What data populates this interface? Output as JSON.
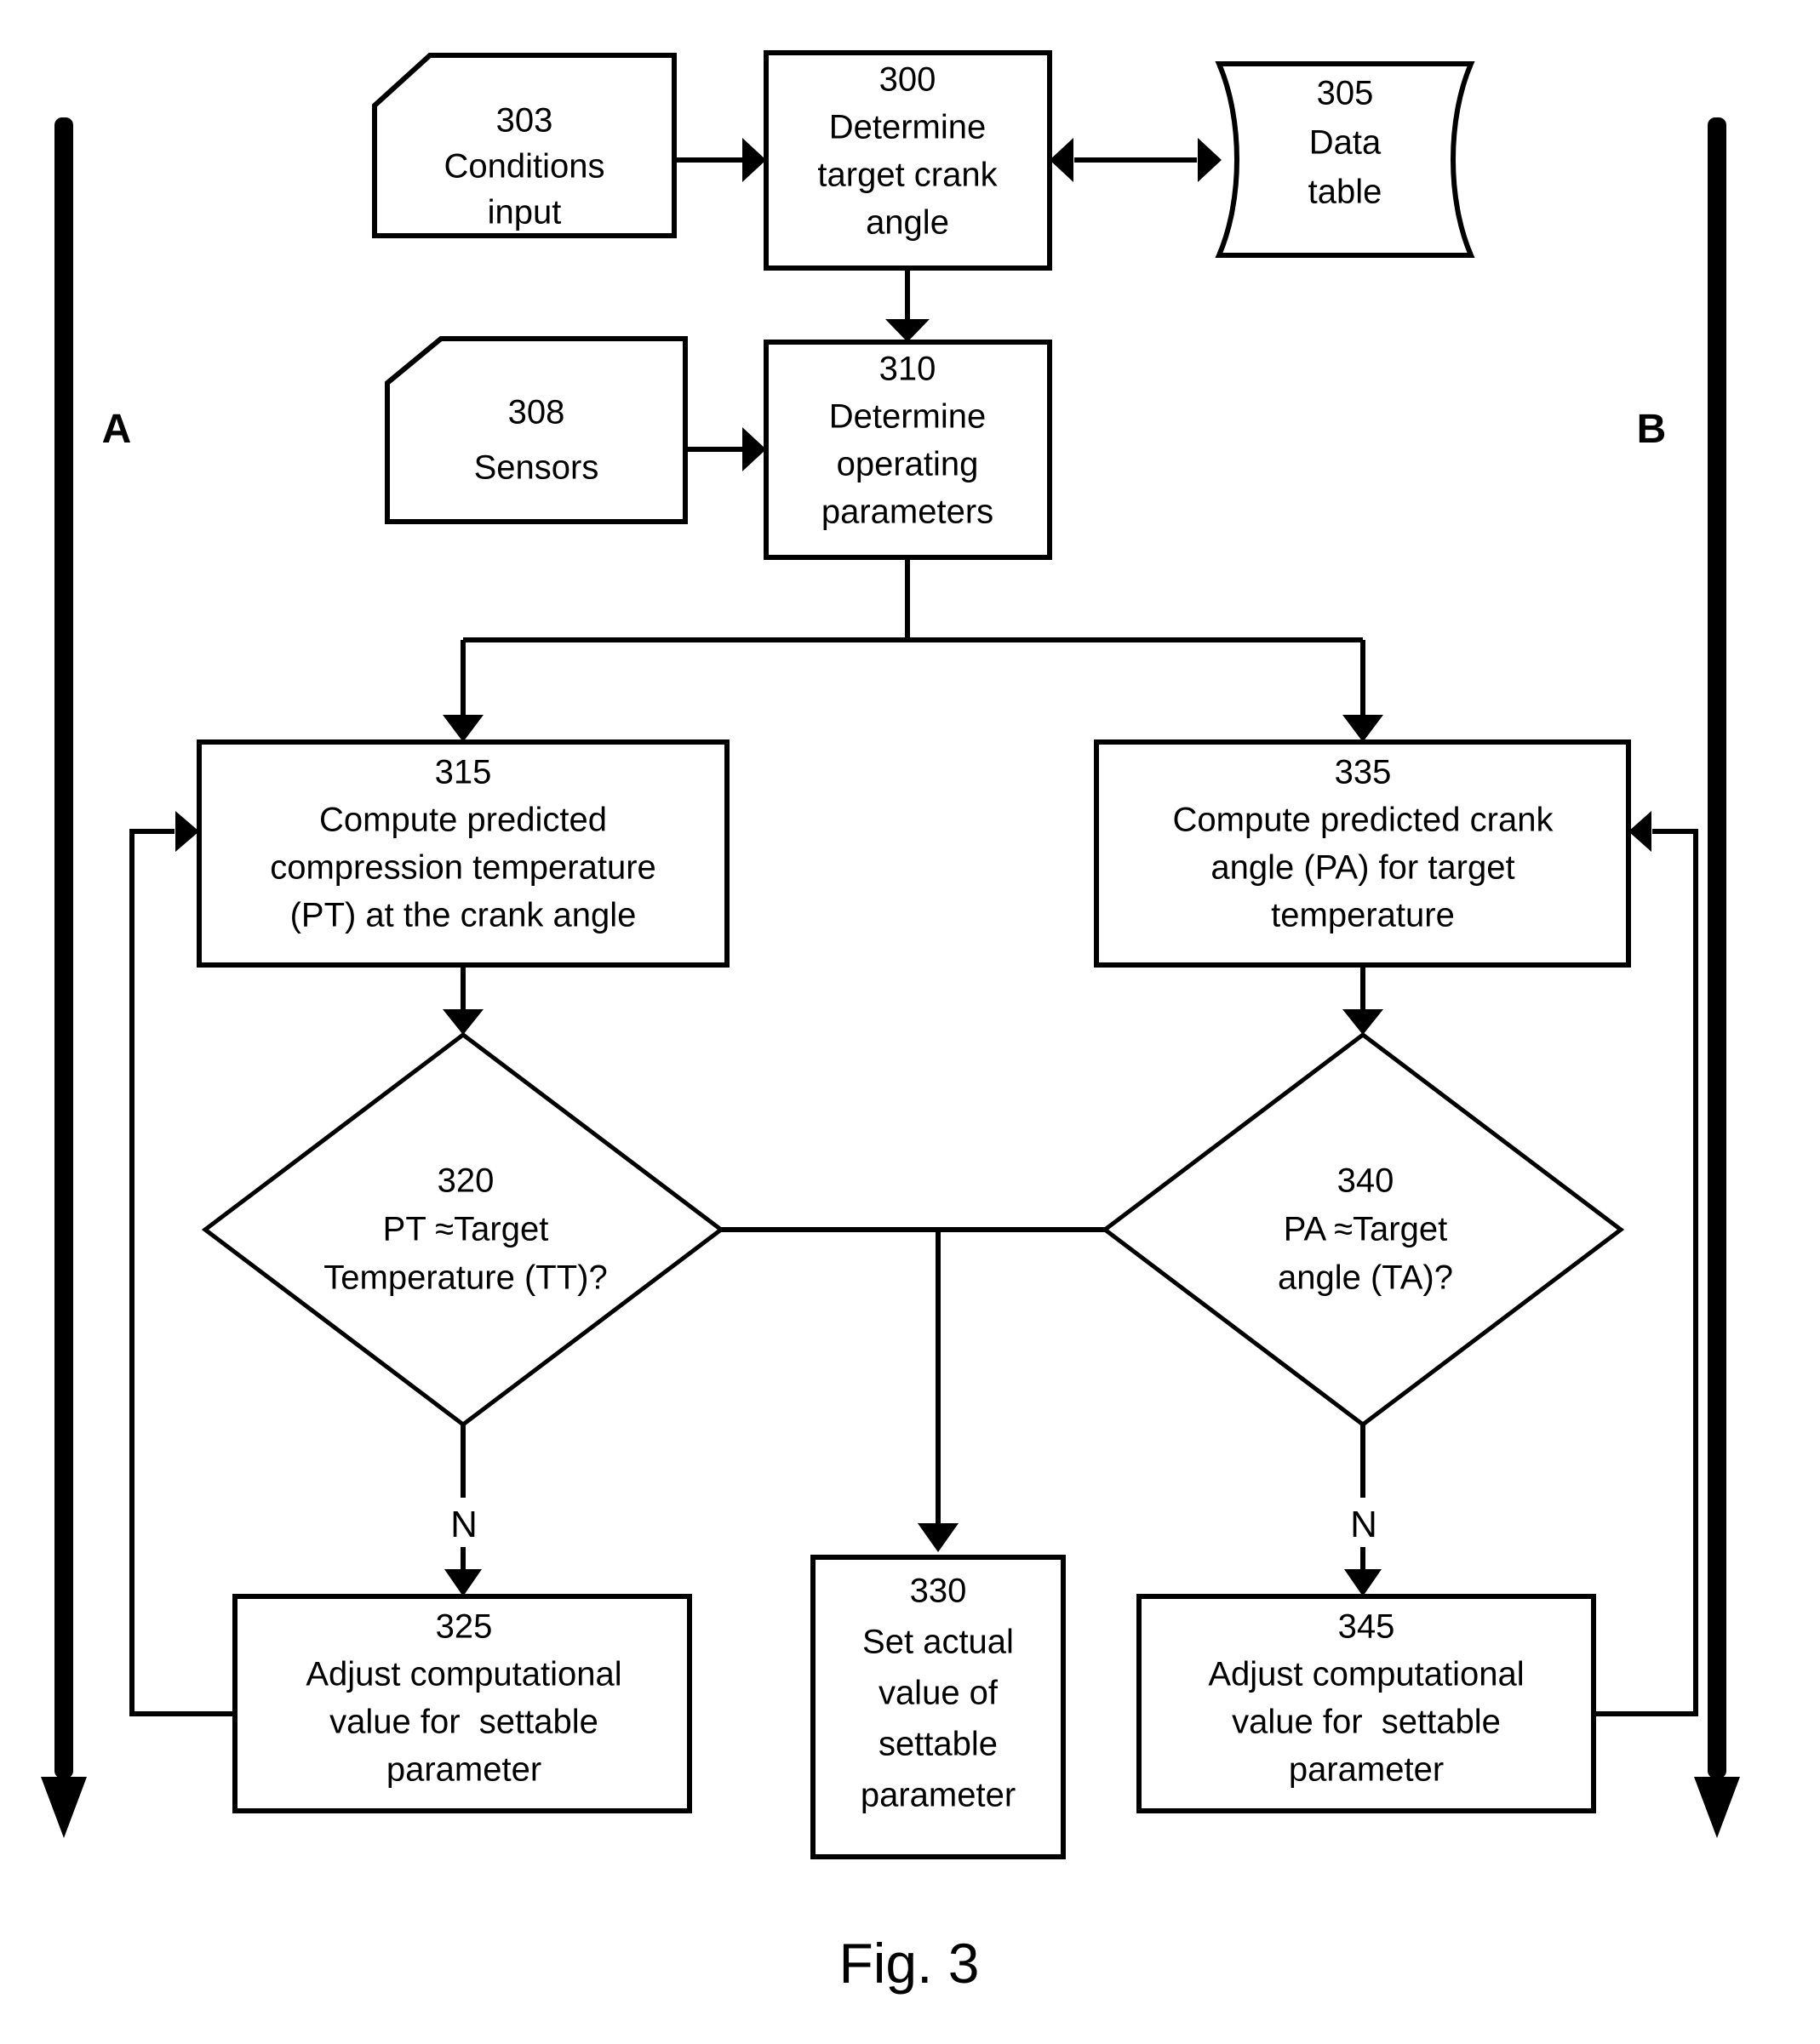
{
  "figure": {
    "caption": "Fig. 3",
    "rail_left_label": "A",
    "rail_right_label": "B"
  },
  "nodes": {
    "n303": {
      "id": "303",
      "line1": "Conditions",
      "line2": "input",
      "shape": "input-cut-corner"
    },
    "n300": {
      "id": "300",
      "line1": "Determine",
      "line2": "target crank",
      "line3": "angle",
      "shape": "process-rect"
    },
    "n305": {
      "id": "305",
      "line1": "Data",
      "line2": "table",
      "shape": "data-tape"
    },
    "n308": {
      "id": "308",
      "line1": "Sensors",
      "shape": "input-cut-corner"
    },
    "n310": {
      "id": "310",
      "line1": "Determine",
      "line2": "operating",
      "line3": "parameters",
      "shape": "process-rect"
    },
    "n315": {
      "id": "315",
      "line1": "Compute predicted",
      "line2": "compression temperature",
      "line3": "(PT) at the crank angle",
      "shape": "process-rect"
    },
    "n335": {
      "id": "335",
      "line1": "Compute predicted crank",
      "line2": "angle (PA) for target",
      "line3": "temperature",
      "shape": "process-rect"
    },
    "n320": {
      "id": "320",
      "line1": "PT ≈Target",
      "line2": "Temperature (TT)?",
      "shape": "decision-diamond"
    },
    "n340": {
      "id": "340",
      "line1": "PA ≈Target",
      "line2": "angle (TA)?",
      "shape": "decision-diamond"
    },
    "n325": {
      "id": "325",
      "line1": "Adjust computational",
      "line2": "value for  settable",
      "line3": "parameter",
      "shape": "process-rect"
    },
    "n330": {
      "id": "330",
      "line1": "Set actual",
      "line2": "value of",
      "line3": "settable",
      "line4": "parameter",
      "shape": "process-rect"
    },
    "n345": {
      "id": "345",
      "line1": "Adjust computational",
      "line2": "value for  settable",
      "line3": "parameter",
      "shape": "process-rect"
    }
  },
  "edge_labels": {
    "left_no": "N",
    "right_no": "N"
  },
  "colors": {
    "ink": "#000000",
    "paper": "#ffffff"
  }
}
